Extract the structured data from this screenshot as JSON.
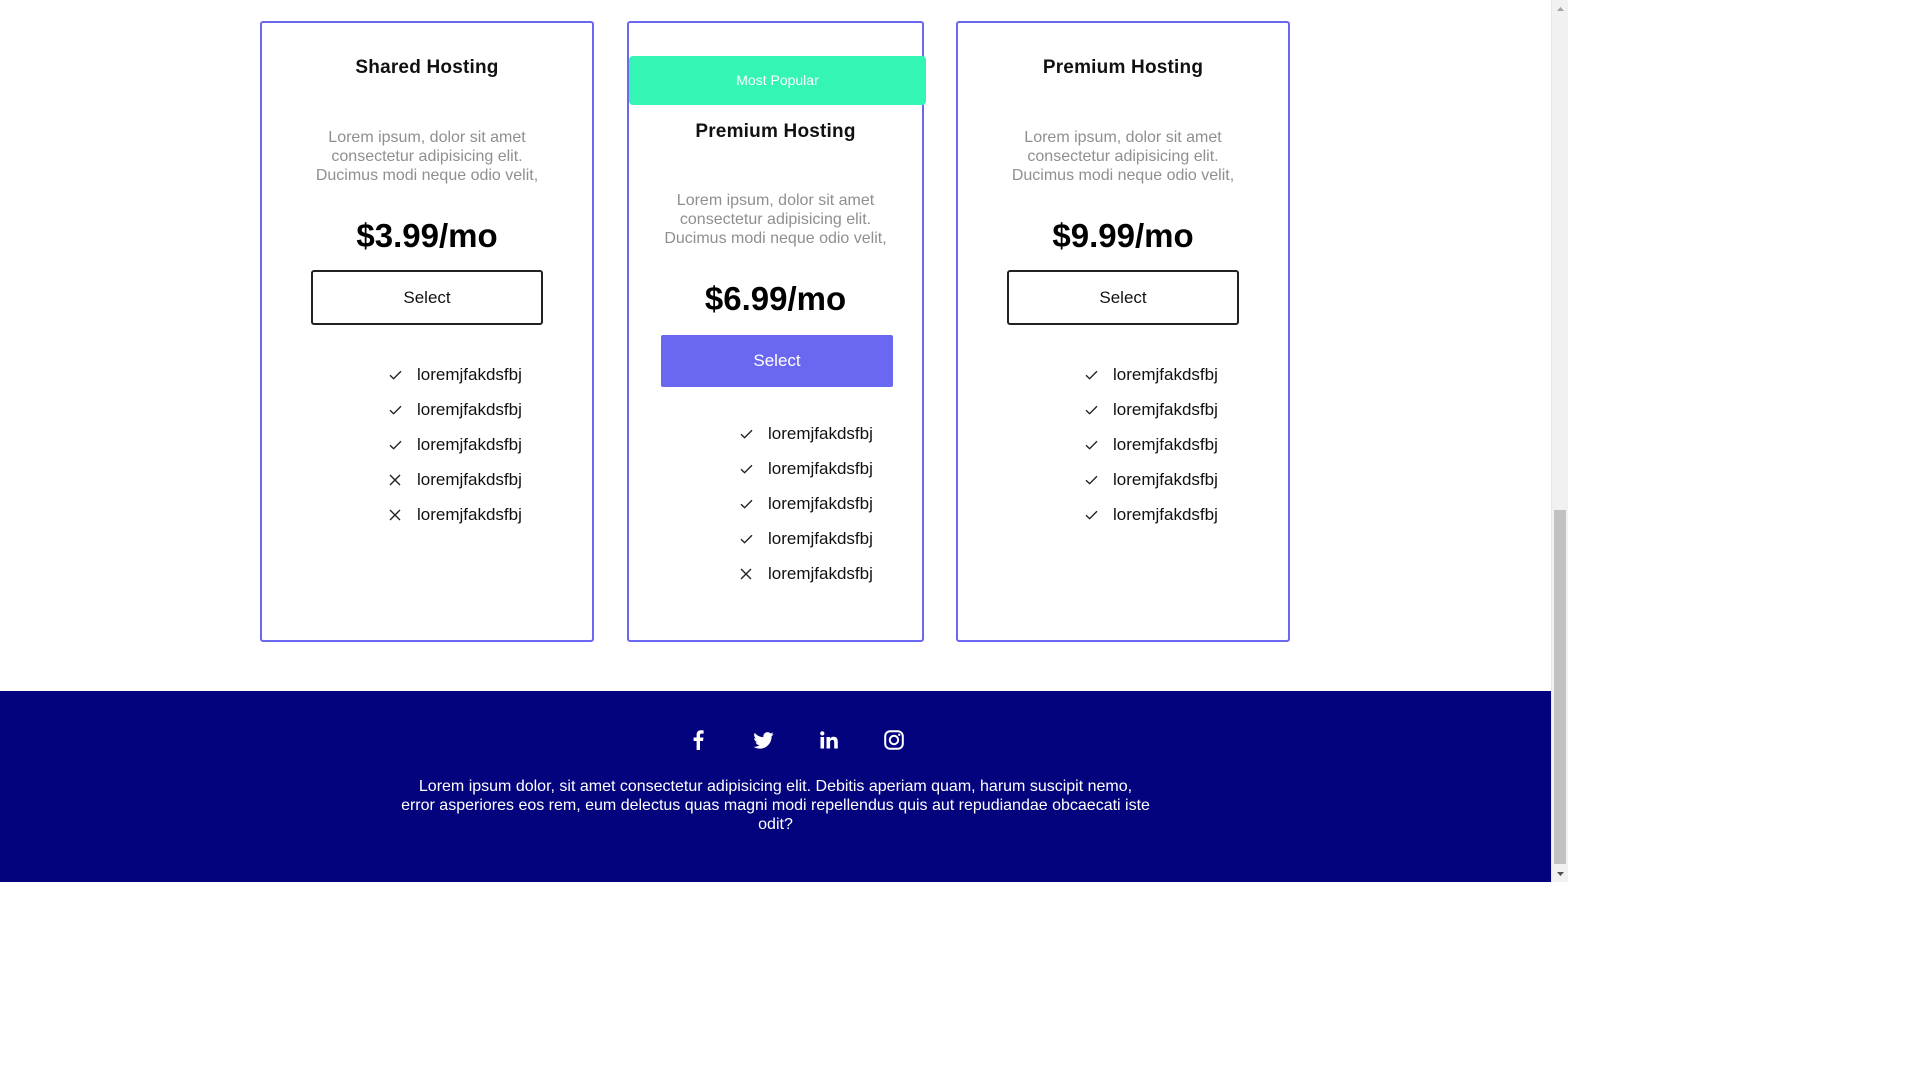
{
  "cards": [
    {
      "title": "Shared Hosting",
      "description": "Lorem ipsum, dolor sit amet consectetur adipisicing elit. Ducimus modi neque odio velit,",
      "price": "$3.99/mo",
      "select_label": "Select",
      "features": [
        {
          "label": "loremjfakdsfbj",
          "included": true
        },
        {
          "label": "loremjfakdsfbj",
          "included": true
        },
        {
          "label": "loremjfakdsfbj",
          "included": true
        },
        {
          "label": "loremjfakdsfbj",
          "included": false
        },
        {
          "label": "loremjfakdsfbj",
          "included": false
        }
      ]
    },
    {
      "badge": "Most Popular",
      "title": "Premium Hosting",
      "description": "Lorem ipsum, dolor sit amet consectetur adipisicing elit. Ducimus modi neque odio velit,",
      "price": "$6.99/mo",
      "select_label": "Select",
      "features": [
        {
          "label": "loremjfakdsfbj",
          "included": true
        },
        {
          "label": "loremjfakdsfbj",
          "included": true
        },
        {
          "label": "loremjfakdsfbj",
          "included": true
        },
        {
          "label": "loremjfakdsfbj",
          "included": true
        },
        {
          "label": "loremjfakdsfbj",
          "included": false
        }
      ]
    },
    {
      "title": "Premium Hosting",
      "description": "Lorem ipsum, dolor sit amet consectetur adipisicing elit. Ducimus modi neque odio velit,",
      "price": "$9.99/mo",
      "select_label": "Select",
      "features": [
        {
          "label": "loremjfakdsfbj",
          "included": true
        },
        {
          "label": "loremjfakdsfbj",
          "included": true
        },
        {
          "label": "loremjfakdsfbj",
          "included": true
        },
        {
          "label": "loremjfakdsfbj",
          "included": true
        },
        {
          "label": "loremjfakdsfbj",
          "included": true
        }
      ]
    }
  ],
  "footer": {
    "social_icons": [
      "facebook-icon",
      "twitter-icon",
      "linkedin-icon",
      "instagram-icon"
    ],
    "text": "Lorem ipsum dolor, sit amet consectetur adipisicing elit. Debitis aperiam quam, harum suscipit nemo, error asperiores eos rem, eum delectus quas magni modi repellendus quis aut repudiandae obcaecati iste odit?"
  },
  "colors": {
    "accent": "#6a67f0",
    "badge": "#34f5b4",
    "footer_bg": "#03037e",
    "muted_text": "#8f8f8f"
  }
}
